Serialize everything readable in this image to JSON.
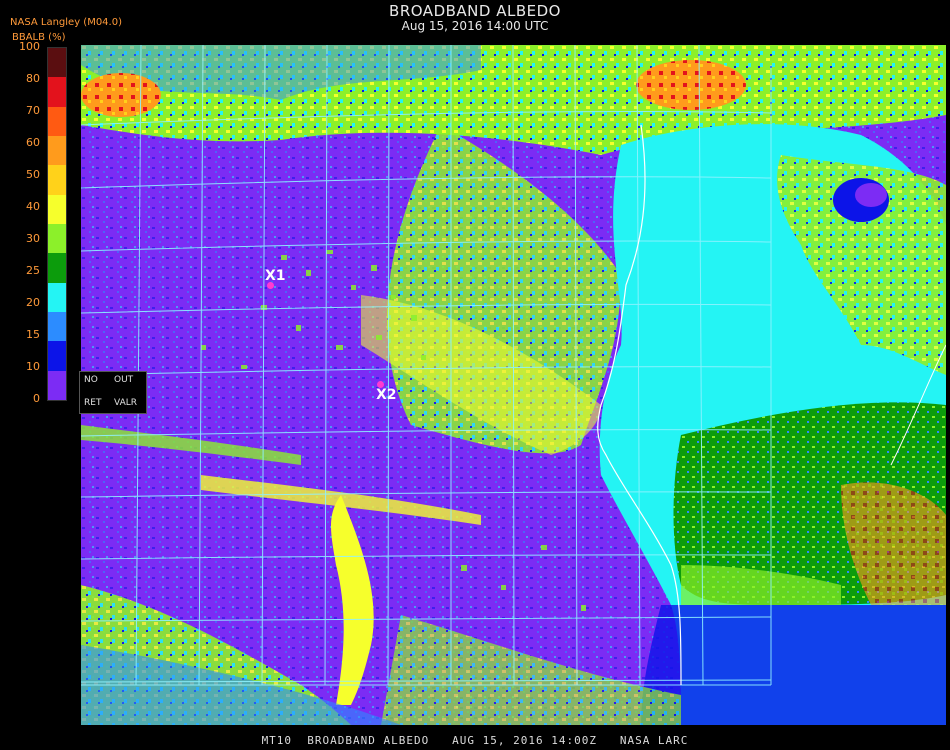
{
  "header": {
    "title": "BROADBAND ALBEDO",
    "subtitle": "Aug 15, 2016 14:00 UTC",
    "org_label": "NASA Langley (M04.0)",
    "unit_label": "BBALB (%)"
  },
  "colorbar": {
    "ticks": [
      "100",
      "80",
      "70",
      "60",
      "50",
      "40",
      "30",
      "25",
      "20",
      "15",
      "10",
      "0"
    ],
    "colors": [
      "#5a0e10",
      "#e3121c",
      "#ff5a12",
      "#ff9b1c",
      "#ffd21a",
      "#f6ff2c",
      "#8cf02a",
      "#0c9c0c",
      "#24f4f4",
      "#2c8cff",
      "#0c14e8",
      "#7c2cf4"
    ]
  },
  "legend_box": {
    "no_label": "NO",
    "out_label": "OUT",
    "ret_label": "RET",
    "valr_label": "VALR"
  },
  "markers": [
    {
      "label": "X1"
    },
    {
      "label": "X2"
    }
  ],
  "footer": {
    "text": "MT10  BROADBAND ALBEDO   AUG 15, 2016 14:00Z   NASA LARC"
  },
  "palette": {
    "ocean_clear": "#7c2cf4",
    "land_dry": "#24f4f4",
    "land_veg": "#0c9c0c",
    "grid": "#8ff2ff"
  }
}
